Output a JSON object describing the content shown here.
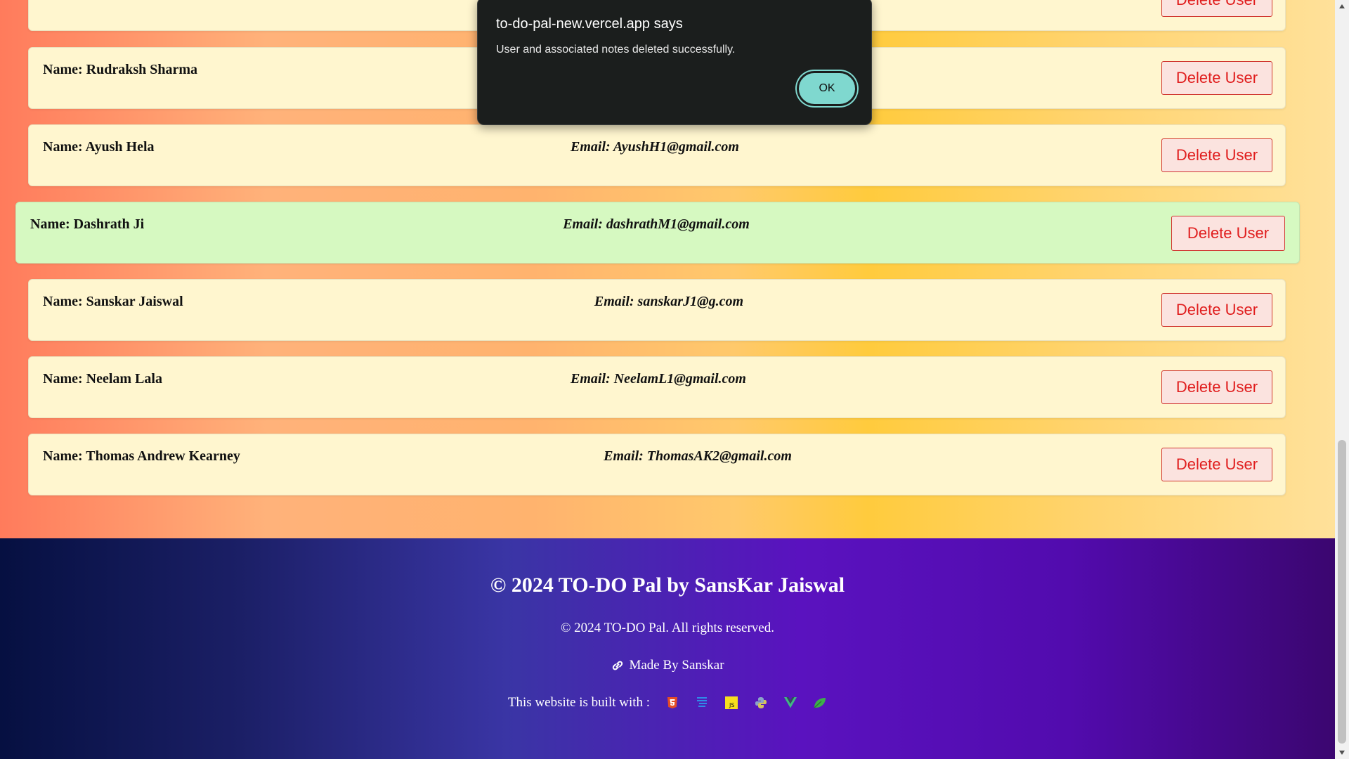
{
  "users": [
    {
      "name": "",
      "email": "",
      "button": "Delete User"
    },
    {
      "name": "Name: Rudraksh Sharma",
      "email": "",
      "button": "Delete User"
    },
    {
      "name": "Name: Ayush Hela",
      "email": "Email: AyushH1@gmail.com",
      "button": "Delete User"
    },
    {
      "name": "Name: Dashrath Ji",
      "email": "Email: dashrathM1@gmail.com",
      "button": "Delete User"
    },
    {
      "name": "Name: Sanskar Jaiswal",
      "email": "Email: sanskarJ1@g.com",
      "button": "Delete User"
    },
    {
      "name": "Name: Neelam Lala",
      "email": "Email: NeelamL1@gmail.com",
      "button": "Delete User"
    },
    {
      "name": "Name: Thomas Andrew Kearney",
      "email": "Email: ThomasAK2@gmail.com",
      "button": "Delete User"
    }
  ],
  "dialog": {
    "title": "to-do-pal-new.vercel.app says",
    "message": "User and associated notes deleted successfully.",
    "ok_label": "OK"
  },
  "footer": {
    "title": "© 2024 TO-DO Pal by SansKar Jaiswal",
    "rights": "© 2024 TO-DO Pal. All rights reserved.",
    "made_by": "Made By Sanskar",
    "built_with": "This website is built with :",
    "tech_icons": [
      "html5-icon",
      "css3-icon",
      "javascript-icon",
      "python-icon",
      "vue-icon",
      "mongodb-leaf-icon"
    ]
  },
  "colors": {
    "delete_text": "#e01e1e",
    "row_bg": "#fff6cf",
    "highlight_row_bg": "#d6f9c1",
    "ok_button": "#7fd8cf"
  }
}
